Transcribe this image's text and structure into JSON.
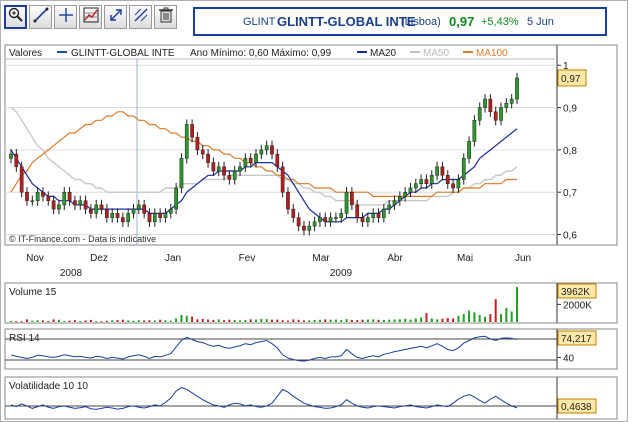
{
  "toolbar": {
    "icons": [
      "zoom-icon",
      "line-tool-icon",
      "cross-tool-icon",
      "chart-grid-icon",
      "fit-icon",
      "zoom-fit-icon",
      "trash-icon"
    ]
  },
  "quote": {
    "ticker": "GLINT",
    "name": "GLINTT-GLOBAL INTE",
    "exchange": "(Lisboa)",
    "price": "0,97",
    "change": "+5,43%",
    "date": "5 Jun",
    "up_color": "#0a8a1a",
    "brand_color": "#1a3fa0"
  },
  "chart_data": [
    {
      "type": "candlestick",
      "title": "Valores",
      "legend": [
        {
          "label": "GLINTT-GLOBAL INTE",
          "color": "#1a4fb0"
        },
        {
          "label": "Ano Mínimo: 0,60 Máximo: 0,99",
          "color": ""
        },
        {
          "label": "MA20",
          "color": "#1a2aa0"
        },
        {
          "label": "MA50",
          "color": "#c0c0c0"
        },
        {
          "label": "MA100",
          "color": "#e07a2a"
        }
      ],
      "watermark": "© IT-Finance.com - Data is indicative",
      "ylim": [
        0.58,
        1.01
      ],
      "yticks": [
        "1",
        "0,9",
        "0,8",
        "0,7",
        "0,6"
      ],
      "ytick_values": [
        1.0,
        0.9,
        0.8,
        0.7,
        0.6
      ],
      "current_label": "0,97",
      "current_value": 0.97,
      "x_months": [
        "Nov",
        "Dez",
        "Jan",
        "Fev",
        "Mar",
        "Abr",
        "Mai",
        "Jun"
      ],
      "years": [
        "2008",
        "2009"
      ],
      "closes": [
        0.79,
        0.76,
        0.7,
        0.68,
        0.68,
        0.7,
        0.69,
        0.68,
        0.66,
        0.67,
        0.7,
        0.68,
        0.67,
        0.68,
        0.66,
        0.65,
        0.67,
        0.66,
        0.64,
        0.65,
        0.64,
        0.63,
        0.65,
        0.66,
        0.67,
        0.65,
        0.63,
        0.65,
        0.64,
        0.65,
        0.66,
        0.71,
        0.78,
        0.86,
        0.83,
        0.8,
        0.79,
        0.77,
        0.75,
        0.76,
        0.74,
        0.73,
        0.75,
        0.76,
        0.78,
        0.77,
        0.79,
        0.8,
        0.81,
        0.79,
        0.76,
        0.7,
        0.66,
        0.64,
        0.62,
        0.61,
        0.62,
        0.63,
        0.64,
        0.63,
        0.64,
        0.64,
        0.65,
        0.7,
        0.67,
        0.64,
        0.63,
        0.64,
        0.65,
        0.64,
        0.66,
        0.67,
        0.68,
        0.69,
        0.7,
        0.71,
        0.72,
        0.73,
        0.72,
        0.74,
        0.76,
        0.74,
        0.72,
        0.71,
        0.73,
        0.78,
        0.82,
        0.87,
        0.9,
        0.92,
        0.89,
        0.87,
        0.9,
        0.91,
        0.92,
        0.97
      ],
      "ma20": [
        0.8,
        0.78,
        0.76,
        0.74,
        0.72,
        0.71,
        0.7,
        0.69,
        0.69,
        0.68,
        0.68,
        0.68,
        0.67,
        0.67,
        0.67,
        0.66,
        0.66,
        0.66,
        0.66,
        0.66,
        0.66,
        0.66,
        0.66,
        0.66,
        0.66,
        0.66,
        0.65,
        0.65,
        0.65,
        0.65,
        0.66,
        0.67,
        0.68,
        0.7,
        0.71,
        0.72,
        0.73,
        0.74,
        0.74,
        0.75,
        0.75,
        0.75,
        0.75,
        0.75,
        0.76,
        0.76,
        0.77,
        0.77,
        0.77,
        0.77,
        0.76,
        0.75,
        0.74,
        0.72,
        0.7,
        0.68,
        0.66,
        0.65,
        0.64,
        0.63,
        0.63,
        0.63,
        0.63,
        0.64,
        0.64,
        0.64,
        0.64,
        0.65,
        0.65,
        0.65,
        0.66,
        0.66,
        0.67,
        0.68,
        0.69,
        0.7,
        0.7,
        0.71,
        0.71,
        0.72,
        0.72,
        0.73,
        0.73,
        0.73,
        0.73,
        0.74,
        0.75,
        0.76,
        0.78,
        0.79,
        0.8,
        0.81,
        0.82,
        0.83,
        0.84,
        0.85
      ],
      "ma50": [
        0.9,
        0.89,
        0.87,
        0.85,
        0.83,
        0.81,
        0.8,
        0.78,
        0.77,
        0.76,
        0.75,
        0.74,
        0.73,
        0.73,
        0.72,
        0.72,
        0.71,
        0.71,
        0.7,
        0.7,
        0.7,
        0.7,
        0.7,
        0.7,
        0.7,
        0.7,
        0.7,
        0.7,
        0.7,
        0.71,
        0.71,
        0.71,
        0.72,
        0.72,
        0.72,
        0.72,
        0.73,
        0.73,
        0.73,
        0.73,
        0.73,
        0.74,
        0.74,
        0.74,
        0.74,
        0.74,
        0.74,
        0.74,
        0.74,
        0.74,
        0.74,
        0.73,
        0.73,
        0.72,
        0.72,
        0.71,
        0.71,
        0.7,
        0.7,
        0.69,
        0.69,
        0.68,
        0.68,
        0.68,
        0.68,
        0.67,
        0.67,
        0.67,
        0.67,
        0.67,
        0.67,
        0.68,
        0.68,
        0.68,
        0.68,
        0.68,
        0.68,
        0.68,
        0.68,
        0.69,
        0.69,
        0.69,
        0.69,
        0.7,
        0.7,
        0.71,
        0.71,
        0.72,
        0.72,
        0.73,
        0.73,
        0.74,
        0.74,
        0.75,
        0.75,
        0.76
      ],
      "ma100": [
        0.7,
        0.72,
        0.74,
        0.75,
        0.77,
        0.78,
        0.79,
        0.8,
        0.81,
        0.82,
        0.83,
        0.84,
        0.84,
        0.85,
        0.86,
        0.86,
        0.87,
        0.87,
        0.88,
        0.88,
        0.89,
        0.89,
        0.88,
        0.88,
        0.87,
        0.87,
        0.86,
        0.86,
        0.85,
        0.85,
        0.84,
        0.84,
        0.83,
        0.83,
        0.82,
        0.82,
        0.81,
        0.81,
        0.8,
        0.8,
        0.79,
        0.79,
        0.78,
        0.78,
        0.77,
        0.77,
        0.76,
        0.76,
        0.75,
        0.75,
        0.74,
        0.74,
        0.73,
        0.73,
        0.72,
        0.72,
        0.72,
        0.71,
        0.71,
        0.71,
        0.71,
        0.7,
        0.7,
        0.7,
        0.7,
        0.7,
        0.7,
        0.7,
        0.69,
        0.69,
        0.69,
        0.69,
        0.69,
        0.69,
        0.69,
        0.69,
        0.69,
        0.69,
        0.69,
        0.69,
        0.7,
        0.7,
        0.7,
        0.7,
        0.7,
        0.71,
        0.71,
        0.71,
        0.71,
        0.72,
        0.72,
        0.72,
        0.72,
        0.73,
        0.73,
        0.73
      ]
    },
    {
      "type": "bar",
      "title": "Volume 15",
      "current_label": "3962K",
      "yticks": [
        "2000K"
      ],
      "ytick_values": [
        2000
      ],
      "ylim": [
        0,
        4200
      ],
      "values": [
        120,
        90,
        80,
        300,
        150,
        200,
        180,
        100,
        300,
        250,
        120,
        160,
        200,
        90,
        180,
        240,
        100,
        80,
        140,
        200,
        220,
        260,
        180,
        150,
        210,
        170,
        200,
        180,
        260,
        190,
        150,
        400,
        800,
        700,
        600,
        300,
        350,
        280,
        240,
        300,
        200,
        260,
        240,
        190,
        220,
        300,
        280,
        350,
        330,
        260,
        280,
        200,
        150,
        300,
        250,
        180,
        200,
        230,
        250,
        300,
        260,
        280,
        220,
        330,
        240,
        210,
        260,
        280,
        300,
        250,
        230,
        260,
        280,
        300,
        350,
        270,
        400,
        520,
        1000,
        420,
        300,
        380,
        450,
        400,
        700,
        900,
        1300,
        1100,
        800,
        600,
        900,
        2600,
        900,
        1600,
        1200,
        3962
      ]
    },
    {
      "type": "line",
      "title": "RSI 14",
      "current_label": "74,217",
      "yticks": [
        "40"
      ],
      "ytick_values": [
        40
      ],
      "ylim": [
        20,
        90
      ],
      "values": [
        45,
        42,
        40,
        38,
        40,
        44,
        43,
        41,
        40,
        42,
        45,
        43,
        41,
        42,
        40,
        39,
        42,
        41,
        38,
        40,
        39,
        37,
        41,
        43,
        45,
        42,
        38,
        42,
        41,
        44,
        47,
        60,
        72,
        78,
        74,
        70,
        68,
        64,
        61,
        63,
        59,
        57,
        60,
        62,
        66,
        64,
        68,
        70,
        72,
        66,
        58,
        45,
        39,
        36,
        34,
        33,
        35,
        38,
        40,
        38,
        41,
        41,
        43,
        55,
        47,
        40,
        38,
        41,
        43,
        41,
        46,
        48,
        51,
        53,
        55,
        57,
        59,
        61,
        58,
        62,
        66,
        61,
        55,
        53,
        58,
        67,
        72,
        77,
        79,
        80,
        75,
        72,
        76,
        77,
        76,
        74
      ]
    },
    {
      "type": "line",
      "title": "Volatilidade 10 10",
      "current_label": "0,4638",
      "ylim": [
        0.2,
        1.3
      ],
      "values": [
        0.55,
        0.5,
        0.58,
        0.52,
        0.45,
        0.5,
        0.55,
        0.48,
        0.45,
        0.5,
        0.52,
        0.48,
        0.45,
        0.47,
        0.5,
        0.44,
        0.42,
        0.45,
        0.48,
        0.46,
        0.43,
        0.45,
        0.5,
        0.52,
        0.48,
        0.46,
        0.5,
        0.55,
        0.52,
        0.62,
        0.75,
        0.95,
        1.05,
        1.0,
        0.9,
        0.8,
        0.7,
        0.62,
        0.55,
        0.52,
        0.48,
        0.55,
        0.6,
        0.58,
        0.52,
        0.55,
        0.5,
        0.48,
        0.52,
        0.6,
        0.8,
        1.0,
        0.92,
        0.8,
        0.7,
        0.6,
        0.55,
        0.5,
        0.48,
        0.45,
        0.46,
        0.5,
        0.55,
        0.7,
        0.6,
        0.52,
        0.48,
        0.46,
        0.5,
        0.52,
        0.5,
        0.48,
        0.46,
        0.5,
        0.52,
        0.55,
        0.5,
        0.48,
        0.46,
        0.5,
        0.55,
        0.52,
        0.5,
        0.6,
        0.72,
        0.8,
        0.85,
        0.78,
        0.68,
        0.6,
        0.72,
        0.8,
        0.7,
        0.6,
        0.52,
        0.4638
      ]
    }
  ]
}
